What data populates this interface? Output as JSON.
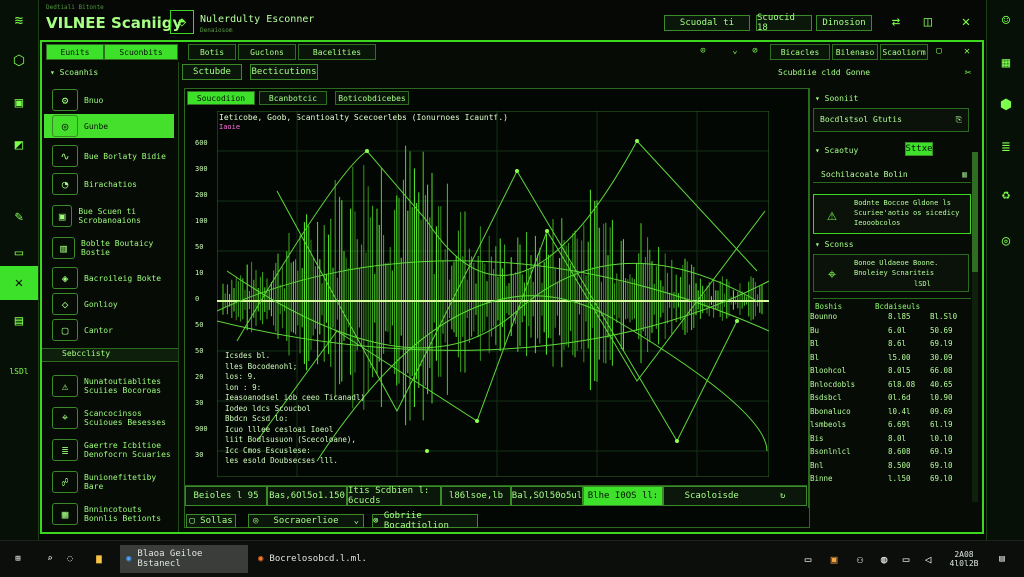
{
  "app": {
    "brand_small": "Dedtiali Bitonte",
    "title": "VILNEE Scaniigy",
    "subtitle": "Nulerdulty Esconner",
    "subtitle_sub": "Denaiosom"
  },
  "top_buttons": [
    "Scuodal ti",
    "Scuocid 18",
    "Dinosion"
  ],
  "menu_tabs": [
    "Eunits",
    "Scuonbits",
    "Botis",
    "Guclons",
    "Bacelities"
  ],
  "window_controls": [
    "Bicacles",
    "Bilenaso",
    "Scaoliorm"
  ],
  "sidebar": {
    "header": "Scoanhis",
    "items": [
      {
        "icon": "gear-icon",
        "label": "Bnuo"
      },
      {
        "icon": "target-icon",
        "label": "Gunbe"
      },
      {
        "icon": "wave-icon",
        "label": "Bue Borlaty Bidie"
      },
      {
        "icon": "gauge-icon",
        "label": "Birachatios"
      },
      {
        "icon": "chip-icon",
        "label": "Bue Scuen ti Scrobanoaions"
      },
      {
        "icon": "chart-icon",
        "label": "Boblte Boutaicy Bostie"
      },
      {
        "icon": "cube-icon",
        "label": "Bacroileig Bokte"
      },
      {
        "icon": "shield-icon",
        "label": "Gonlioy"
      },
      {
        "icon": "lock-icon",
        "label": "Cantor"
      }
    ],
    "section2": "Sebcclisty",
    "cards": [
      {
        "title": "Nunatoutiablites",
        "sub": "Scuiies Bocoroas"
      },
      {
        "title": "Scancocinsos",
        "sub": "Scuioues Besesses"
      },
      {
        "title": "Gaertre Icbitioe",
        "sub": "Denofocrn Scuaries"
      },
      {
        "title": "Bunionefitetiby",
        "sub": "Bare"
      },
      {
        "title": "Bnnincotouts",
        "sub": "Bonnlis Betionts"
      }
    ]
  },
  "toolbar": {
    "tab1": "Sctubde",
    "tab2": "Becticutions",
    "right1": "Scubdiie cldd",
    "right2": "Gonne"
  },
  "plot_tabs": [
    "Soucodiion",
    "Bcanbotcic",
    "Boticobdicebes"
  ],
  "plot_label": "Ieticobe, Goob, Scantioalty Scecoerlebs (Ionurnoes Icauntf.)",
  "plot_label2": "Iaoie",
  "y_ticks": [
    "600",
    "300",
    "200",
    "100",
    "50",
    "10",
    "0",
    "50",
    "50",
    "20",
    "30",
    "900",
    "30"
  ],
  "code_lines": [
    "Icsdes bl.",
    "lles Bocodenohl;",
    "los: 9.",
    "lon : 9:",
    "Ieasoanodsel iob ceeo Ticanadl)",
    "Iodeo ldcs Scoucbol",
    "Bbdcn Scsd lo:",
    "Icuo lllee cesloai Ioeol",
    "liit Bodlsusuon (Scecoloane),",
    "Icc Cmos Escuslese:",
    "les esold Doubsecses lll."
  ],
  "status": [
    {
      "label": "Beioles",
      "value": "l 95"
    },
    {
      "label": "Bas,6Ol5o1.150",
      "value": ""
    },
    {
      "label": "Itis Scdbien l: 6cucds",
      "value": ""
    },
    {
      "label": "l86lsoe,lb",
      "value": ""
    },
    {
      "label": "Bal,SOl50o5ul",
      "value": ""
    },
    {
      "label": "Blhe I0OS ll:",
      "value": ""
    },
    {
      "label": "Scaoloisde",
      "value": ""
    }
  ],
  "bottom": {
    "btn1": "Sollas",
    "dropdown": "Socraoerlioe",
    "btn3": "Gobriie Bocadtiolion"
  },
  "right_panel": {
    "section1": "Sooniit",
    "field1": "Bocdlstsol Gtutis",
    "section2": "Scaotuy",
    "badge": "Sttxe",
    "field2": "Sochilacoale Bolin",
    "alert_title": "Bodnte Boccoe Gldone ls",
    "alert_text": "Scuriee'aotio os sicedicy",
    "alert_sub": "Ieooobcolos",
    "section3": "Sconss",
    "card_title": "Bonoe Uldaeoe Boone.",
    "card_text": "Bnoleiey Scnariteis",
    "card_sub": "lSDl",
    "table_headers": [
      "Boshis",
      "Bcdaiseuls",
      ""
    ],
    "table": [
      [
        "Bounno",
        "8.l85",
        "Bl.Sl0"
      ],
      [
        "Bu",
        "6.0l",
        "50.69"
      ],
      [
        "Bl",
        "8.6l",
        "69.l9"
      ],
      [
        "Bl",
        "l5.00",
        "30.09"
      ],
      [
        "Bloohcol",
        "8.0l5",
        "66.08"
      ],
      [
        "Bnlocdobls",
        "6l8.08",
        "40.65"
      ],
      [
        "Bsdsbcl",
        "0l.6d",
        "l0.90"
      ],
      [
        "Bbonaluco",
        "l0.4l",
        "09.69"
      ],
      [
        "lsmbeols",
        "6.69l",
        "6l.l9"
      ],
      [
        "Bis",
        "8.0l",
        "l0.l0"
      ],
      [
        "Bsonlnlcl",
        "8.608",
        "69.l9"
      ],
      [
        "Bnl",
        "8.500",
        "69.l0"
      ],
      [
        "Binne",
        "l.l50",
        "69.l0"
      ]
    ]
  },
  "taskbar": {
    "app1": "Blaoa Geiloe Bstanecl",
    "app2": "Bocrelosobcd.l.ml.",
    "time": "2A08",
    "date": "4l0l2B"
  },
  "colors": {
    "accent": "#3ee12a",
    "bg": "#060b06",
    "border": "#2b6a1e"
  }
}
